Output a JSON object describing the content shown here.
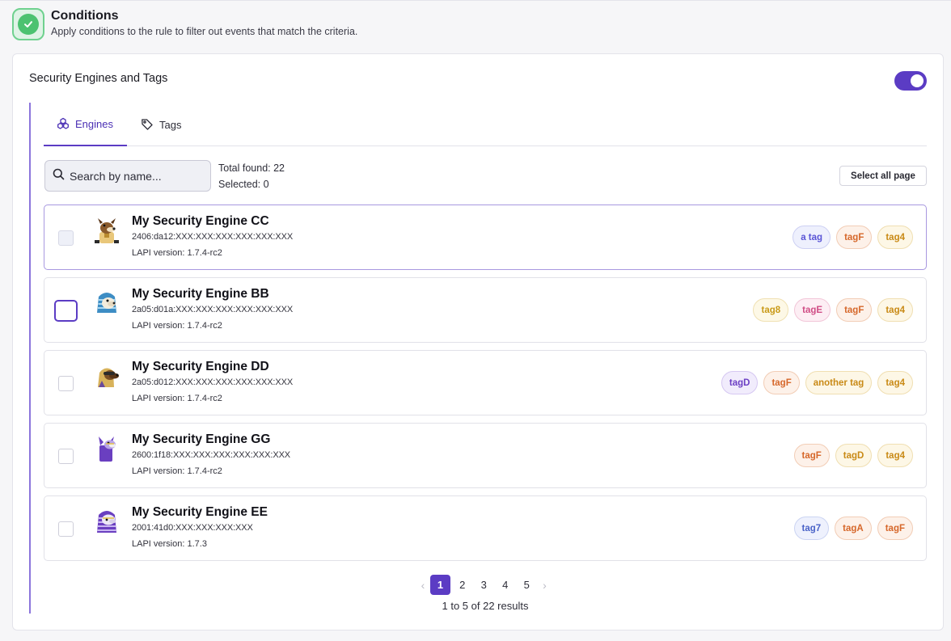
{
  "header": {
    "title": "Conditions",
    "subtitle": "Apply conditions to the rule to filter out events that match the criteria.",
    "icon": "check-circle-icon",
    "accent": "#4cc270"
  },
  "card": {
    "title": "Security Engines and Tags",
    "toggle_on": true,
    "accent": "#5b3cc4"
  },
  "tabs": [
    {
      "label": "Engines",
      "icon": "engines-icon",
      "active": true
    },
    {
      "label": "Tags",
      "icon": "tag-icon",
      "active": false
    }
  ],
  "search": {
    "placeholder": "Search by name...",
    "value": ""
  },
  "totals": {
    "total_found": "Total found: 22",
    "selected": "Selected: 0"
  },
  "select_all_label": "Select all page",
  "engines": [
    {
      "name": "My Security Engine CC",
      "ip": "2406:da12:XXX:XXX:XXX:XXX:XXX:XXX",
      "lapi": "LAPI version: 1.7.4-rc2",
      "avatar": "dog-mascot",
      "checked": false,
      "tags": [
        {
          "label": "a tag",
          "color": "#5a55d6",
          "bg": "#eef0fd",
          "border": "#cdd0f3"
        },
        {
          "label": "tagF",
          "color": "#d6672a",
          "bg": "#fdf1e9",
          "border": "#f2cdb6"
        },
        {
          "label": "tag4",
          "color": "#c98a16",
          "bg": "#fdf7e6",
          "border": "#f0dfb2"
        }
      ]
    },
    {
      "name": "My Security Engine BB",
      "ip": "2a05:d01a:XXX:XXX:XXX:XXX:XXX:XXX",
      "lapi": "LAPI version: 1.7.4-rc2",
      "avatar": "blue-pharaoh-mascot",
      "checked": false,
      "tags": [
        {
          "label": "tag8",
          "color": "#c99a18",
          "bg": "#fdf8e6",
          "border": "#f0e1b3"
        },
        {
          "label": "tagE",
          "color": "#d04d86",
          "bg": "#fdeef4",
          "border": "#f2c6d8"
        },
        {
          "label": "tagF",
          "color": "#d6672a",
          "bg": "#fdf1e9",
          "border": "#f2cdb6"
        },
        {
          "label": "tag4",
          "color": "#c98a16",
          "bg": "#fdf7e6",
          "border": "#f0dfb2"
        }
      ]
    },
    {
      "name": "My Security Engine DD",
      "ip": "2a05:d012:XXX:XXX:XXX:XXX:XXX:XXX",
      "lapi": "LAPI version: 1.7.4-rc2",
      "avatar": "gold-dog-mascot",
      "checked": false,
      "tags": [
        {
          "label": "tagD",
          "color": "#6c3fc4",
          "bg": "#f1ecfc",
          "border": "#d6c8f2"
        },
        {
          "label": "tagF",
          "color": "#d6672a",
          "bg": "#fdf1e9",
          "border": "#f2cdb6"
        },
        {
          "label": "another tag",
          "color": "#c98a16",
          "bg": "#fdf7e6",
          "border": "#f0dfb2"
        },
        {
          "label": "tag4",
          "color": "#c98a16",
          "bg": "#fdf7e6",
          "border": "#f0dfb2"
        }
      ]
    },
    {
      "name": "My Security Engine GG",
      "ip": "2600:1f18:XXX:XXX:XXX:XXX:XXX:XXX",
      "lapi": "LAPI version: 1.7.4-rc2",
      "avatar": "purple-creature-mascot",
      "checked": false,
      "tags": [
        {
          "label": "tagF",
          "color": "#d6672a",
          "bg": "#fdf1e9",
          "border": "#f2cdb6"
        },
        {
          "label": "tagD",
          "color": "#c98a16",
          "bg": "#fdf7e6",
          "border": "#f0dfb2"
        },
        {
          "label": "tag4",
          "color": "#c98a16",
          "bg": "#fdf7e6",
          "border": "#f0dfb2"
        }
      ]
    },
    {
      "name": "My Security Engine EE",
      "ip": "2001:41d0:XXX:XXX:XXX:XXX",
      "lapi": "LAPI version: 1.7.3",
      "avatar": "purple-pharaoh-mascot",
      "checked": false,
      "tags": [
        {
          "label": "tag7",
          "color": "#4a63c8",
          "bg": "#eef1fd",
          "border": "#cbd4f2"
        },
        {
          "label": "tagA",
          "color": "#d6672a",
          "bg": "#fdf1e9",
          "border": "#f2cdb6"
        },
        {
          "label": "tagF",
          "color": "#d6672a",
          "bg": "#fdf1e9",
          "border": "#f2cdb6"
        }
      ]
    }
  ],
  "pagination": {
    "pages": [
      "1",
      "2",
      "3",
      "4",
      "5"
    ],
    "current": "1",
    "summary": "1 to 5 of 22 results"
  }
}
